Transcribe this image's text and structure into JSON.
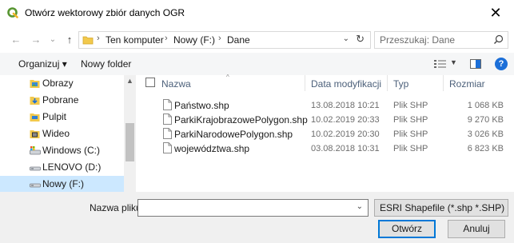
{
  "window": {
    "title": "Otwórz wektorowy zbiór danych OGR",
    "close_glyph": "✕"
  },
  "nav": {
    "back_glyph": "←",
    "forward_glyph": "→",
    "recent_glyph": "⌄",
    "up_glyph": "↑",
    "breadcrumbs": [
      "Ten komputer",
      "Nowy (F:)",
      "Dane"
    ],
    "crumb_separator": "›",
    "dropdown_glyph": "⌄",
    "refresh_glyph": "↻",
    "search_placeholder": "Przeszukaj: Dane"
  },
  "toolbar": {
    "organize_label": "Organizuj ▾",
    "new_folder_label": "Nowy folder",
    "view_drop_glyph": "▼",
    "help_label": "?"
  },
  "sidebar": {
    "scroll_up_glyph": "▲",
    "items": [
      {
        "label": "Obrazy",
        "icon": "pictures-icon"
      },
      {
        "label": "Pobrane",
        "icon": "downloads-icon"
      },
      {
        "label": "Pulpit",
        "icon": "desktop-icon"
      },
      {
        "label": "Wideo",
        "icon": "videos-icon"
      },
      {
        "label": "Windows (C:)",
        "icon": "drive-c-icon"
      },
      {
        "label": "LENOVO (D:)",
        "icon": "drive-d-icon"
      },
      {
        "label": "Nowy (F:)",
        "icon": "drive-f-icon",
        "selected": true
      }
    ]
  },
  "file_list": {
    "sort_glyph": "^",
    "columns": {
      "name": "Nazwa",
      "modified": "Data modyfikacji",
      "type": "Typ",
      "size": "Rozmiar"
    },
    "rows": [
      {
        "name": "Państwo.shp",
        "modified": "13.08.2018 10:21",
        "type": "Plik SHP",
        "size": "1 068 KB"
      },
      {
        "name": "ParkiKrajobrazowePolygon.shp",
        "modified": "10.02.2019 20:33",
        "type": "Plik SHP",
        "size": "9 270 KB"
      },
      {
        "name": "ParkiNarodowePolygon.shp",
        "modified": "10.02.2019 20:30",
        "type": "Plik SHP",
        "size": "3 026 KB"
      },
      {
        "name": "województwa.shp",
        "modified": "03.08.2018 10:31",
        "type": "Plik SHP",
        "size": "6 823 KB"
      }
    ]
  },
  "footer": {
    "filename_label": "Nazwa pliku:",
    "filename_value": "",
    "filename_drop_glyph": "⌄",
    "filter_value": "ESRI Shapefile (*.shp *.SHP)",
    "filter_drop_glyph": "⌄",
    "open_label": "Otwórz",
    "cancel_label": "Anuluj"
  },
  "colors": {
    "qgis_green": "#589632",
    "selection": "#cce8ff",
    "accent_blue": "#0078d7",
    "folder_yellow": "#f2c94c"
  }
}
